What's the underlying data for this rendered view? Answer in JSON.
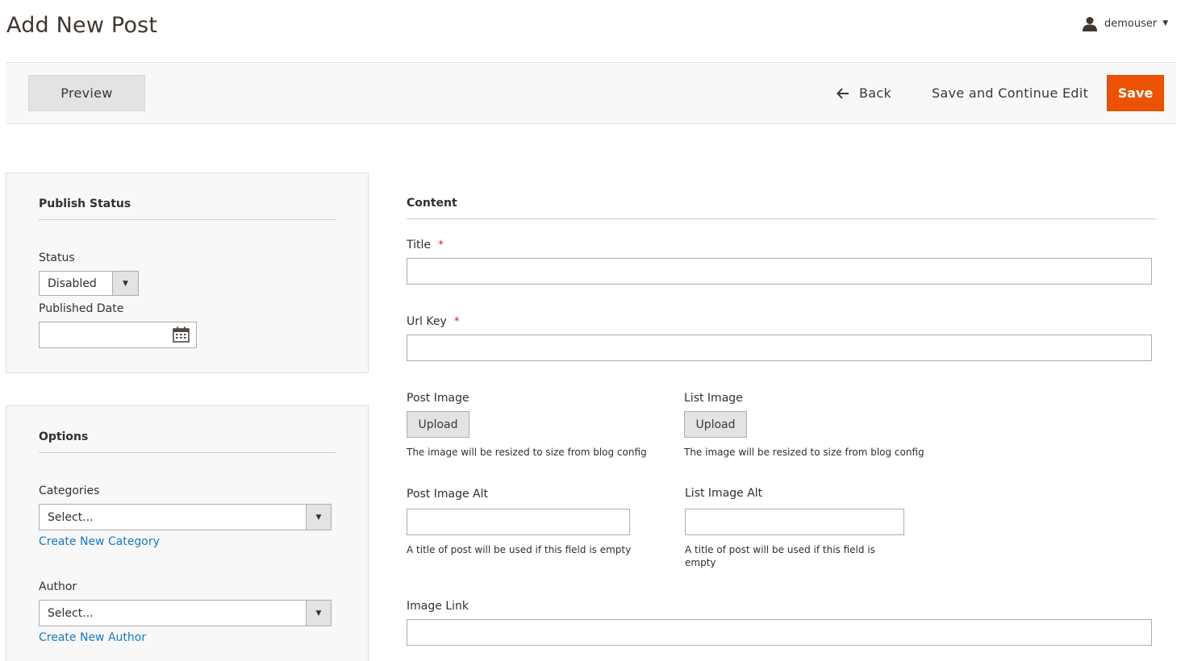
{
  "page": {
    "title": "Add New Post"
  },
  "user": {
    "name": "demouser",
    "icon": "user-icon"
  },
  "toolbar": {
    "preview_label": "Preview",
    "back_label": "Back",
    "save_continue_label": "Save and Continue Edit",
    "save_label": "Save",
    "accent_color": "#eb5202"
  },
  "publish_status": {
    "heading": "Publish Status",
    "status_label": "Status",
    "status_value": "Disabled",
    "published_date_label": "Published Date",
    "published_date_value": ""
  },
  "options": {
    "heading": "Options",
    "categories_label": "Categories",
    "categories_value": "Select...",
    "create_category_link": "Create New Category",
    "author_label": "Author",
    "author_value": "Select...",
    "create_author_link": "Create New Author"
  },
  "content": {
    "heading": "Content",
    "title_label": "Title",
    "title_value": "",
    "url_key_label": "Url Key",
    "url_key_value": "",
    "required_mark": "*",
    "post_image_label": "Post Image",
    "list_image_label": "List Image",
    "upload_label": "Upload",
    "image_note": "The image will be resized to size from blog config",
    "post_image_alt_label": "Post Image Alt",
    "list_image_alt_label": "List Image Alt",
    "alt_note": "A title of post will be used if this field is empty",
    "image_link_label": "Image Link",
    "image_link_value": ""
  }
}
